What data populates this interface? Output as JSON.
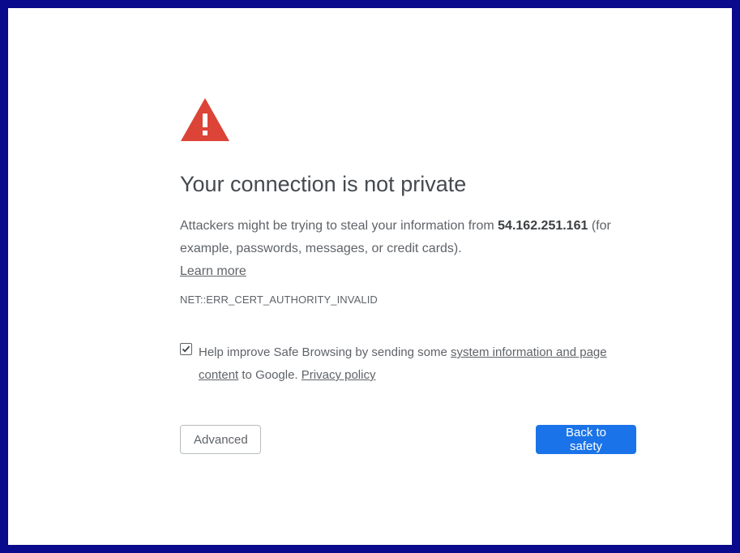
{
  "page": {
    "title": "Your connection is not private",
    "description_prefix": "Attackers might be trying to steal your information from ",
    "host": "54.162.251.161",
    "description_suffix": " (for example, passwords, messages, or credit cards). ",
    "learn_more": "Learn more",
    "error_code": "NET::ERR_CERT_AUTHORITY_INVALID"
  },
  "opt_in": {
    "checked": true,
    "text_prefix": "Help improve Safe Browsing by sending some ",
    "link_system_info": "system information and page content",
    "text_middle": " to Google. ",
    "link_privacy": "Privacy policy"
  },
  "buttons": {
    "advanced_label": "Advanced",
    "back_label": "Back to safety"
  },
  "colors": {
    "frame": "#0a0a8c",
    "warning": "#db4437",
    "primary_button": "#1a73e8"
  },
  "icons": {
    "warning": "warning-triangle-icon",
    "checkbox": "checkmark-icon"
  }
}
